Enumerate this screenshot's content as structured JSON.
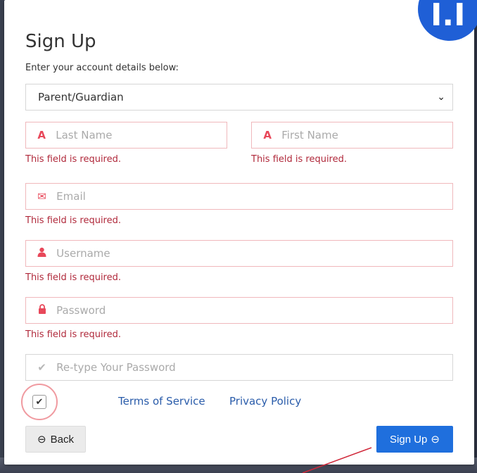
{
  "form": {
    "title": "Sign Up",
    "subtitle": "Enter your account details below:",
    "account_type": "Parent/Guardian",
    "fields": {
      "last_name": {
        "placeholder": "Last Name",
        "error": "This field is required."
      },
      "first_name": {
        "placeholder": "First Name",
        "error": "This field is required."
      },
      "email": {
        "placeholder": "Email",
        "error": "This field is required."
      },
      "username": {
        "placeholder": "Username",
        "error": "This field is required."
      },
      "password": {
        "placeholder": "Password",
        "error": "This field is required."
      },
      "retype_password": {
        "placeholder": "Re-type Your Password"
      }
    },
    "agree_checked": true,
    "links": {
      "terms": "Terms of Service",
      "privacy": "Privacy Policy"
    },
    "buttons": {
      "back": "Back",
      "sign_up": "Sign Up"
    }
  },
  "badge_text": "I.I",
  "colors": {
    "accent": "#1f6fdd",
    "error": "#b0293b",
    "icon_red": "#e8485a",
    "highlight": "#f09aa0"
  }
}
